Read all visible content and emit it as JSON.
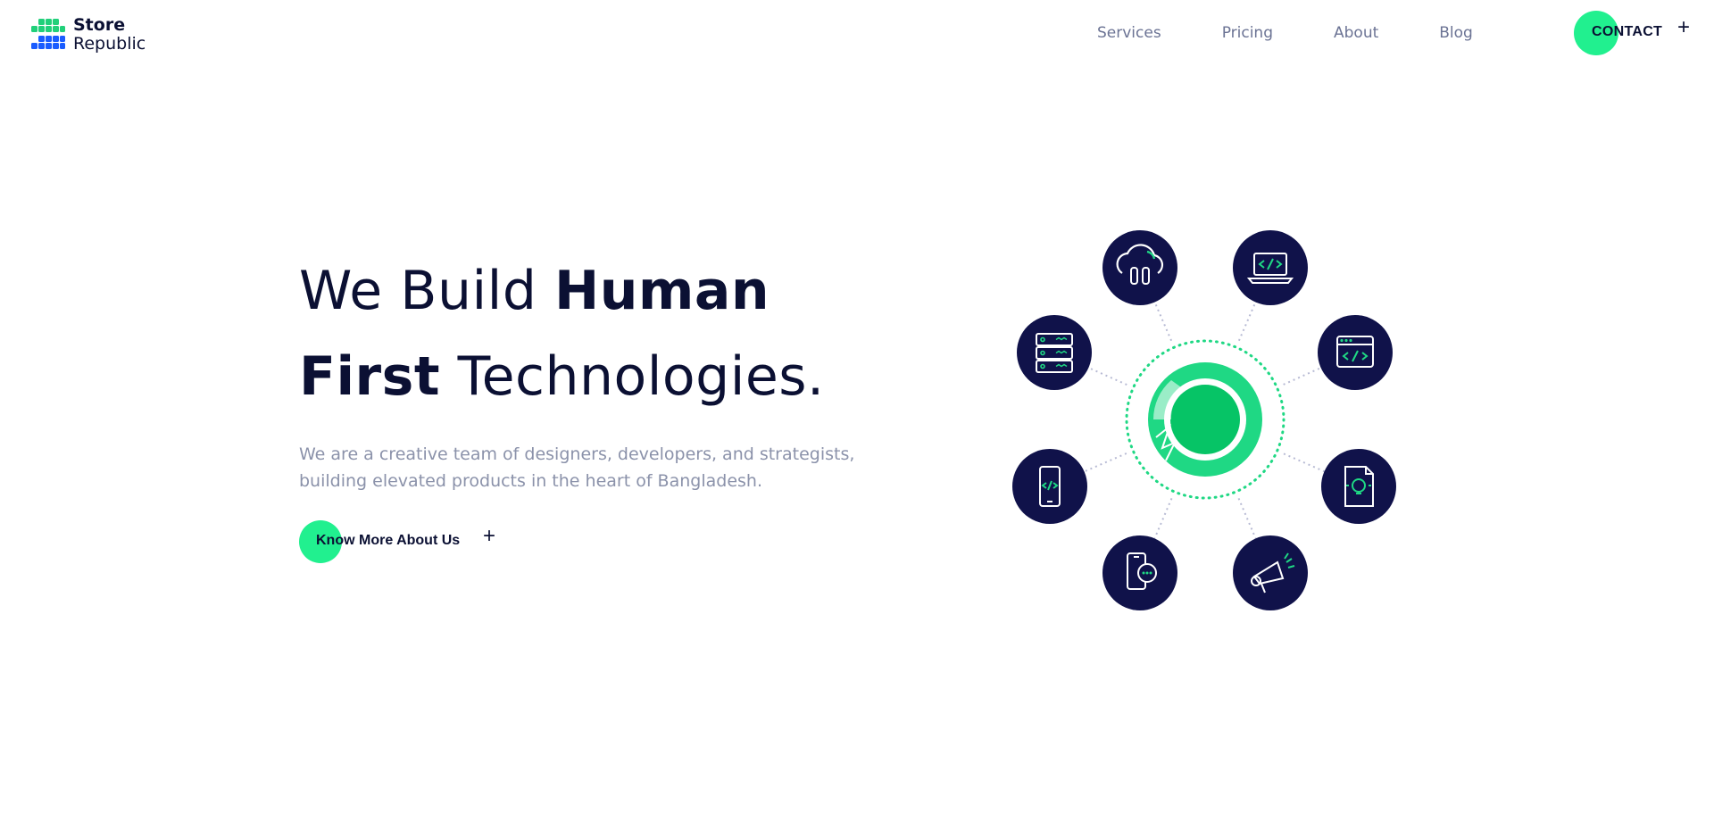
{
  "brand": {
    "name_line1": "Store",
    "name_line2": "Republic",
    "colors": {
      "green": "#21f08f",
      "blue": "#1a5cff",
      "navy": "#0b1033"
    }
  },
  "nav": {
    "items": [
      {
        "label": "Services"
      },
      {
        "label": "Pricing"
      },
      {
        "label": "About"
      },
      {
        "label": "Blog"
      }
    ],
    "contact_label": "CONTACT",
    "contact_icon": "plus-icon"
  },
  "hero": {
    "title_part1": "We Build ",
    "title_bold1": "Human",
    "title_bold2": "First",
    "title_part2": " Technologies.",
    "description": "We are a creative team of designers, developers, and strategists, building elevated products in the heart of Bangladesh.",
    "cta_label": "Know More About Us",
    "cta_icon": "plus-icon"
  },
  "illustration": {
    "center": "store-republic-emblem",
    "icons": [
      "cloud-icon",
      "laptop-code-icon",
      "browser-code-icon",
      "lightbulb-document-icon",
      "megaphone-icon",
      "phone-chat-icon",
      "mobile-code-icon",
      "server-icon"
    ],
    "colors": {
      "bubble": "#10124a",
      "accent": "#1fd884",
      "line": "#c9cbe0"
    }
  }
}
